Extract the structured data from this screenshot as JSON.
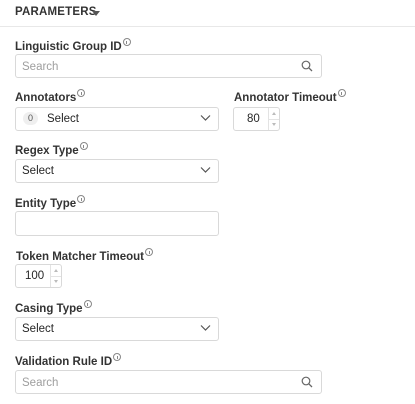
{
  "header": {
    "title": "PARAMETERS",
    "caret_icon": "caret-down-icon"
  },
  "fields": {
    "linguistic_group_id": {
      "label": "Linguistic Group ID",
      "placeholder": "Search"
    },
    "annotators": {
      "label": "Annotators",
      "count": "0",
      "value": "Select"
    },
    "annotator_timeout": {
      "label": "Annotator Timeout",
      "value": "80"
    },
    "regex_type": {
      "label": "Regex Type",
      "value": "Select"
    },
    "entity_type": {
      "label": "Entity Type",
      "value": ""
    },
    "token_matcher_timeout": {
      "label": "Token Matcher Timeout",
      "value": "100"
    },
    "casing_type": {
      "label": "Casing Type",
      "value": "Select"
    },
    "validation_rule_id": {
      "label": "Validation Rule ID",
      "placeholder": "Search"
    }
  }
}
